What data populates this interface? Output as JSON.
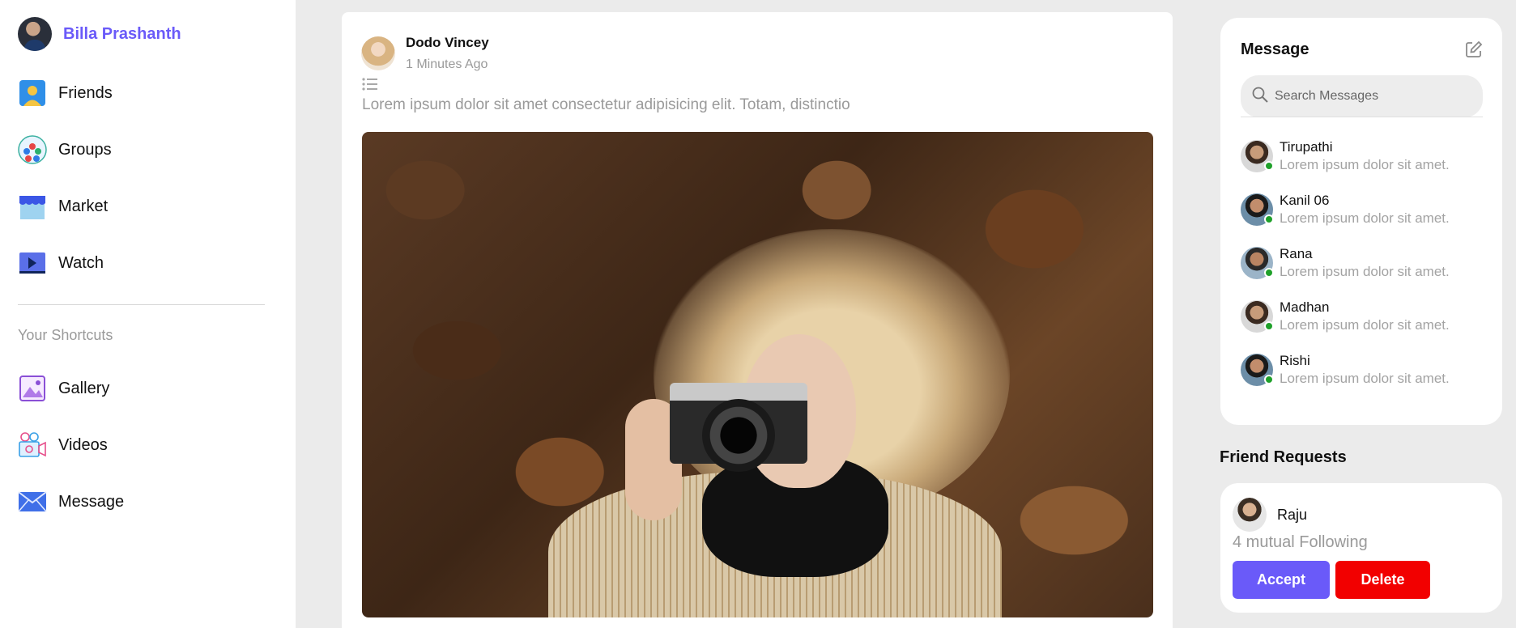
{
  "sidebar": {
    "profile_name": "Billa Prashanth",
    "nav": [
      {
        "label": "Friends",
        "icon": "friends-icon"
      },
      {
        "label": "Groups",
        "icon": "groups-icon"
      },
      {
        "label": "Market",
        "icon": "market-icon"
      },
      {
        "label": "Watch",
        "icon": "watch-icon"
      }
    ],
    "shortcuts_title": "Your Shortcuts",
    "shortcuts": [
      {
        "label": "Gallery",
        "icon": "gallery-icon"
      },
      {
        "label": "Videos",
        "icon": "videos-icon"
      },
      {
        "label": "Message",
        "icon": "message-icon"
      }
    ]
  },
  "post": {
    "author": "Dodo Vincey",
    "time": "1 Minutes Ago",
    "text": "Lorem ipsum dolor sit amet consectetur adipisicing elit. Totam, distinctio"
  },
  "messages": {
    "title": "Message",
    "search_placeholder": "Search Messages",
    "contacts": [
      {
        "name": "Tirupathi",
        "preview": "Lorem ipsum dolor sit amet."
      },
      {
        "name": "Kanil 06",
        "preview": "Lorem ipsum dolor sit amet."
      },
      {
        "name": "Rana",
        "preview": "Lorem ipsum dolor sit amet."
      },
      {
        "name": "Madhan",
        "preview": "Lorem ipsum dolor sit amet."
      },
      {
        "name": "Rishi",
        "preview": "Lorem ipsum dolor sit amet."
      }
    ]
  },
  "friend_requests": {
    "title": "Friend Requests",
    "name": "Raju",
    "mutual": "4 mutual Following",
    "accept_label": "Accept",
    "delete_label": "Delete"
  },
  "colors": {
    "accent": "#6a5af9",
    "danger": "#f20000",
    "online": "#1fa02a"
  }
}
